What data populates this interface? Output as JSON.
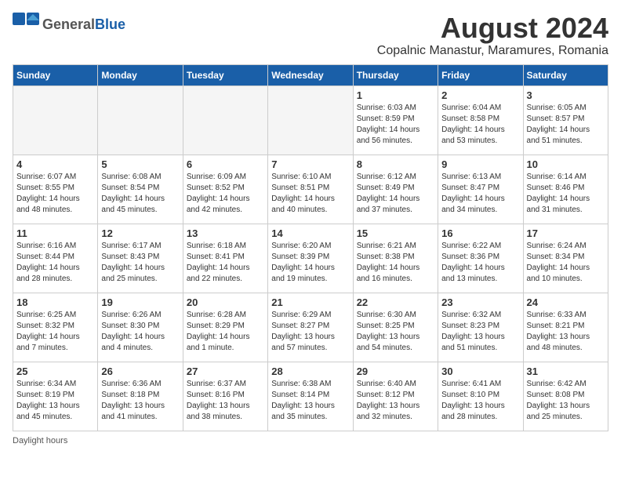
{
  "header": {
    "logo": {
      "general": "General",
      "blue": "Blue",
      "tagline": ""
    },
    "month": "August 2024",
    "location": "Copalnic Manastur, Maramures, Romania"
  },
  "weekdays": [
    "Sunday",
    "Monday",
    "Tuesday",
    "Wednesday",
    "Thursday",
    "Friday",
    "Saturday"
  ],
  "footer": {
    "daylight_label": "Daylight hours"
  },
  "weeks": [
    [
      {
        "day": "",
        "info": ""
      },
      {
        "day": "",
        "info": ""
      },
      {
        "day": "",
        "info": ""
      },
      {
        "day": "",
        "info": ""
      },
      {
        "day": "1",
        "info": "Sunrise: 6:03 AM\nSunset: 8:59 PM\nDaylight: 14 hours\nand 56 minutes."
      },
      {
        "day": "2",
        "info": "Sunrise: 6:04 AM\nSunset: 8:58 PM\nDaylight: 14 hours\nand 53 minutes."
      },
      {
        "day": "3",
        "info": "Sunrise: 6:05 AM\nSunset: 8:57 PM\nDaylight: 14 hours\nand 51 minutes."
      }
    ],
    [
      {
        "day": "4",
        "info": "Sunrise: 6:07 AM\nSunset: 8:55 PM\nDaylight: 14 hours\nand 48 minutes."
      },
      {
        "day": "5",
        "info": "Sunrise: 6:08 AM\nSunset: 8:54 PM\nDaylight: 14 hours\nand 45 minutes."
      },
      {
        "day": "6",
        "info": "Sunrise: 6:09 AM\nSunset: 8:52 PM\nDaylight: 14 hours\nand 42 minutes."
      },
      {
        "day": "7",
        "info": "Sunrise: 6:10 AM\nSunset: 8:51 PM\nDaylight: 14 hours\nand 40 minutes."
      },
      {
        "day": "8",
        "info": "Sunrise: 6:12 AM\nSunset: 8:49 PM\nDaylight: 14 hours\nand 37 minutes."
      },
      {
        "day": "9",
        "info": "Sunrise: 6:13 AM\nSunset: 8:47 PM\nDaylight: 14 hours\nand 34 minutes."
      },
      {
        "day": "10",
        "info": "Sunrise: 6:14 AM\nSunset: 8:46 PM\nDaylight: 14 hours\nand 31 minutes."
      }
    ],
    [
      {
        "day": "11",
        "info": "Sunrise: 6:16 AM\nSunset: 8:44 PM\nDaylight: 14 hours\nand 28 minutes."
      },
      {
        "day": "12",
        "info": "Sunrise: 6:17 AM\nSunset: 8:43 PM\nDaylight: 14 hours\nand 25 minutes."
      },
      {
        "day": "13",
        "info": "Sunrise: 6:18 AM\nSunset: 8:41 PM\nDaylight: 14 hours\nand 22 minutes."
      },
      {
        "day": "14",
        "info": "Sunrise: 6:20 AM\nSunset: 8:39 PM\nDaylight: 14 hours\nand 19 minutes."
      },
      {
        "day": "15",
        "info": "Sunrise: 6:21 AM\nSunset: 8:38 PM\nDaylight: 14 hours\nand 16 minutes."
      },
      {
        "day": "16",
        "info": "Sunrise: 6:22 AM\nSunset: 8:36 PM\nDaylight: 14 hours\nand 13 minutes."
      },
      {
        "day": "17",
        "info": "Sunrise: 6:24 AM\nSunset: 8:34 PM\nDaylight: 14 hours\nand 10 minutes."
      }
    ],
    [
      {
        "day": "18",
        "info": "Sunrise: 6:25 AM\nSunset: 8:32 PM\nDaylight: 14 hours\nand 7 minutes."
      },
      {
        "day": "19",
        "info": "Sunrise: 6:26 AM\nSunset: 8:30 PM\nDaylight: 14 hours\nand 4 minutes."
      },
      {
        "day": "20",
        "info": "Sunrise: 6:28 AM\nSunset: 8:29 PM\nDaylight: 14 hours\nand 1 minute."
      },
      {
        "day": "21",
        "info": "Sunrise: 6:29 AM\nSunset: 8:27 PM\nDaylight: 13 hours\nand 57 minutes."
      },
      {
        "day": "22",
        "info": "Sunrise: 6:30 AM\nSunset: 8:25 PM\nDaylight: 13 hours\nand 54 minutes."
      },
      {
        "day": "23",
        "info": "Sunrise: 6:32 AM\nSunset: 8:23 PM\nDaylight: 13 hours\nand 51 minutes."
      },
      {
        "day": "24",
        "info": "Sunrise: 6:33 AM\nSunset: 8:21 PM\nDaylight: 13 hours\nand 48 minutes."
      }
    ],
    [
      {
        "day": "25",
        "info": "Sunrise: 6:34 AM\nSunset: 8:19 PM\nDaylight: 13 hours\nand 45 minutes."
      },
      {
        "day": "26",
        "info": "Sunrise: 6:36 AM\nSunset: 8:18 PM\nDaylight: 13 hours\nand 41 minutes."
      },
      {
        "day": "27",
        "info": "Sunrise: 6:37 AM\nSunset: 8:16 PM\nDaylight: 13 hours\nand 38 minutes."
      },
      {
        "day": "28",
        "info": "Sunrise: 6:38 AM\nSunset: 8:14 PM\nDaylight: 13 hours\nand 35 minutes."
      },
      {
        "day": "29",
        "info": "Sunrise: 6:40 AM\nSunset: 8:12 PM\nDaylight: 13 hours\nand 32 minutes."
      },
      {
        "day": "30",
        "info": "Sunrise: 6:41 AM\nSunset: 8:10 PM\nDaylight: 13 hours\nand 28 minutes."
      },
      {
        "day": "31",
        "info": "Sunrise: 6:42 AM\nSunset: 8:08 PM\nDaylight: 13 hours\nand 25 minutes."
      }
    ]
  ]
}
